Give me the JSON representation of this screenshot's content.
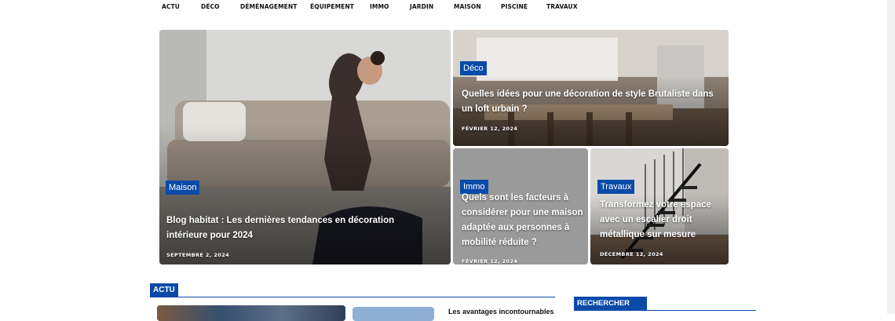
{
  "nav": {
    "items": [
      {
        "label": "ACTU"
      },
      {
        "label": "DÉCO"
      },
      {
        "label": "DÉMÉNAGEMENT"
      },
      {
        "label": "ÉQUIPEMENT"
      },
      {
        "label": "IMMO"
      },
      {
        "label": "JARDIN"
      },
      {
        "label": "MAISON"
      },
      {
        "label": "PISCINE"
      },
      {
        "label": "TRAVAUX"
      }
    ]
  },
  "featured": [
    {
      "category": "Maison",
      "title": "Blog habitat : Les dernières tendances en décoration intérieure pour 2024",
      "date": "SEPTEMBRE 2, 2024"
    },
    {
      "category": "Déco",
      "title": "Quelles idées pour une décoration de style Brutaliste dans un loft urbain ?",
      "date": "FÉVRIER 12, 2024"
    },
    {
      "category": "Immo",
      "title": "Quels sont les facteurs à considérer pour une maison adaptée aux personnes à mobilité réduite ?",
      "date": "FÉVRIER 12, 2024"
    },
    {
      "category": "Travaux",
      "title": "Transformez votre espace avec un escalier droit métallique sur mesure",
      "date": "DÉCEMBRE 12, 2024"
    }
  ],
  "sections": {
    "actu": "ACTU",
    "search": "RECHERCHER"
  },
  "preview_title": "Les avantages incontournables",
  "colors": {
    "accent": "#0a4aa8"
  }
}
